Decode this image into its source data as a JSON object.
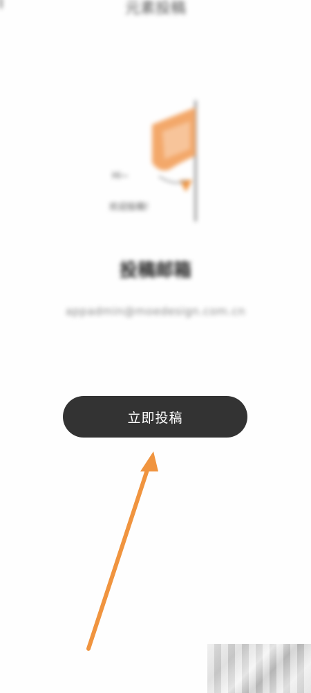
{
  "header": {
    "title": "元素投稿"
  },
  "illustration": {
    "label_top": "Hi~",
    "label_bottom": "欢迎投稿!"
  },
  "content": {
    "heading": "投稿邮箱",
    "email": "appadmin@moedesign.com.cn"
  },
  "actions": {
    "submit_label": "立即投稿"
  },
  "colors": {
    "button_bg": "#333333",
    "button_text": "#ffffff",
    "accent_orange": "#f0943f",
    "flag_orange": "#f3a86a"
  },
  "icons": {
    "back": "back-icon",
    "flag": "flag-illustration",
    "arrow": "pointer-arrow"
  }
}
